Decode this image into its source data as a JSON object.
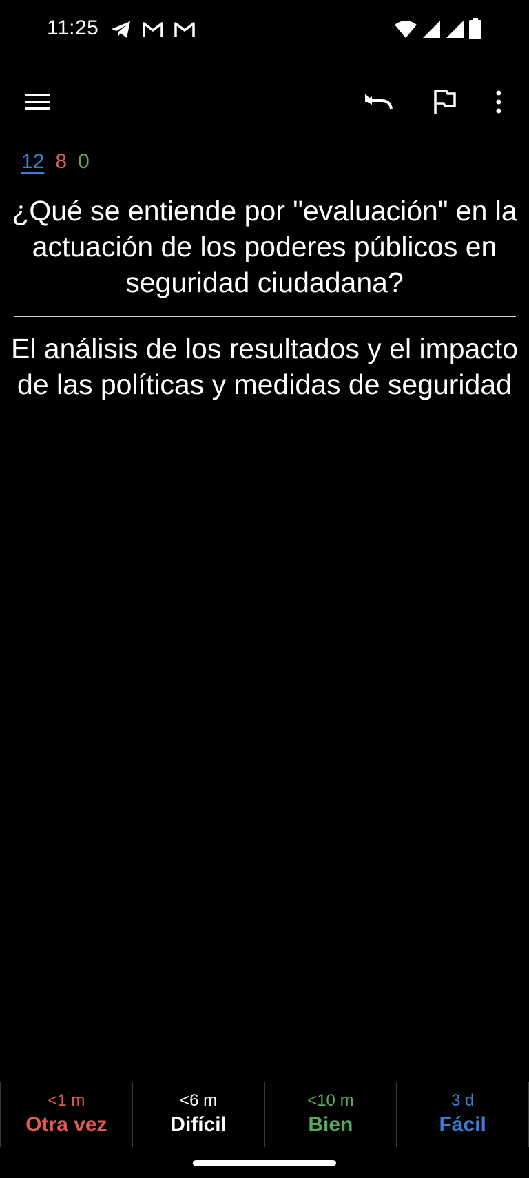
{
  "status_bar": {
    "time": "11:25",
    "left_icons": [
      "telegram-icon",
      "gmail-icon",
      "gmail-icon"
    ],
    "right_icons": [
      "wifi-icon",
      "signal-icon",
      "signal-icon",
      "battery-icon"
    ]
  },
  "toolbar": {
    "menu_icon": "menu-icon",
    "undo_icon": "undo-icon",
    "flag_icon": "flag-icon",
    "more_icon": "more-vert-icon"
  },
  "counts": {
    "new": "12",
    "learning": "8",
    "review": "0"
  },
  "card": {
    "question": "¿Qué se entiende por \"evaluación\" en la actuación de los poderes públicos en seguridad ciudadana?",
    "answer": "El análisis de los resultados y el impacto de las políticas y medidas de seguridad"
  },
  "answer_buttons": [
    {
      "interval": "<1 m",
      "label": "Otra vez"
    },
    {
      "interval": "<6 m",
      "label": "Difícil"
    },
    {
      "interval": "<10 m",
      "label": "Bien"
    },
    {
      "interval": "3 d",
      "label": "Fácil"
    }
  ],
  "colors": {
    "background": "#000000",
    "new": "#3b7fd6",
    "learning": "#e05a55",
    "review": "#5aaa59",
    "text": "#ffffff"
  }
}
